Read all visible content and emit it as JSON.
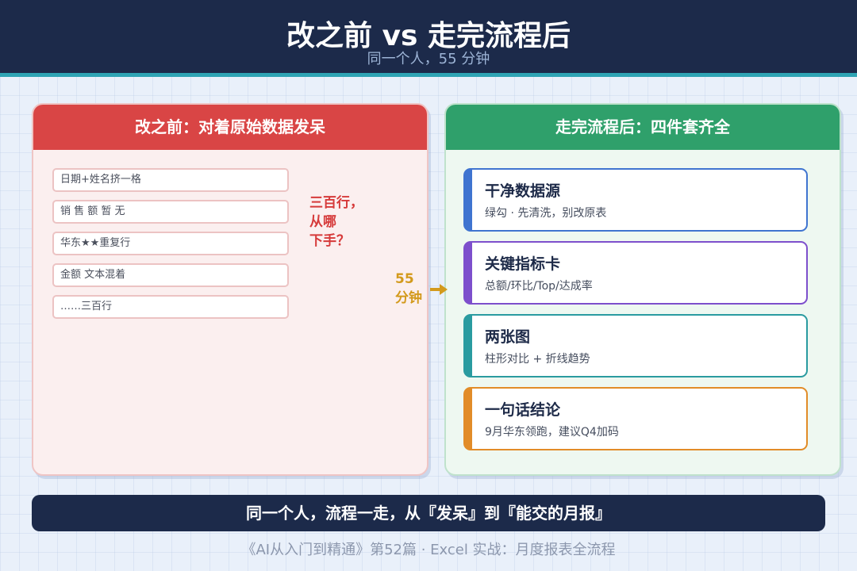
{
  "header": {
    "title": "改之前 vs 走完流程后",
    "subtitle": "同一个人，55 分钟"
  },
  "before": {
    "heading": "改之前：对着原始数据发呆",
    "rows": [
      "日期+姓名挤一格",
      "销 售 额 暂 无",
      "华东★★重复行",
      "金额 文本混着",
      "……三百行"
    ],
    "confused_lines": [
      "三百行，",
      "从哪",
      "下手？"
    ]
  },
  "transition": {
    "time_lines": [
      "55",
      "分钟"
    ]
  },
  "after": {
    "heading": "走完流程后：四件套齐全",
    "cards": [
      {
        "title": "干净数据源",
        "desc": "绿勾 · 先清洗，别改原表",
        "accent": "#3f74d0"
      },
      {
        "title": "关键指标卡",
        "desc": "总额/环比/Top/达成率",
        "accent": "#7d4fcc"
      },
      {
        "title": "两张图",
        "desc": "柱形对比 + 折线趋势",
        "accent": "#2a9ba0"
      },
      {
        "title": "一句话结论",
        "desc": "9月华东领跑，建议Q4加码",
        "accent": "#e28c28"
      }
    ]
  },
  "footer": {
    "banner": "同一个人，流程一走，从『发呆』到『能交的月报』",
    "caption": "《AI从入门到精通》第52篇 · Excel 实战：月度报表全流程"
  },
  "colors": {
    "header_bg": "#1c2a4a",
    "header_stripe": "#2ea4b4",
    "before_accent": "#d94545",
    "after_accent": "#2fa06b",
    "time_accent": "#d39a1c"
  }
}
